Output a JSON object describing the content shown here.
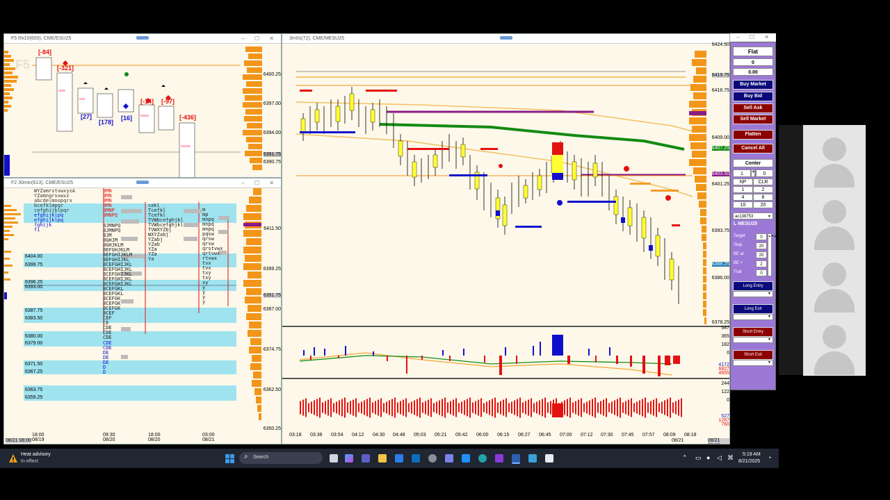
{
  "left_top_window": {
    "title": "F5 Rx10(600), CME/ESU25",
    "watermark": "F5",
    "price_labels": [
      "6400.25",
      "6397.00",
      "6394.00",
      "6391.75",
      "6390.75"
    ],
    "delta_labels": [
      "[-84]",
      "[-321]",
      "[27]",
      "[178]",
      "[16]",
      "[-14]",
      "[-97]",
      "[-436]"
    ]
  },
  "left_bottom_window": {
    "title": "F2 30min(613), CME/ESU25",
    "price_labels": [
      "6411.50",
      "6399.25",
      "6387.00",
      "6374.75",
      "6362.50",
      "6350.25"
    ],
    "level_labels": [
      "6404.00",
      "6399.75",
      "6396.25",
      "6393.00",
      "6387.75",
      "6383.50",
      "6380.00",
      "6379.00",
      "6371.50",
      "6367.25",
      "6363.75",
      "6359.25"
    ],
    "time_labels": [
      "18:00\n08/19",
      "09:30\n08/20",
      "18:00\n08/20",
      "03:00\n08/21"
    ],
    "date_label": "08/21 08:00",
    "last_price": "6391.75"
  },
  "main_window": {
    "title": "3m0s(72), CME/MESU25",
    "price_labels": [
      "6419.75",
      "6416.75",
      "6409.00",
      "6401.25",
      "6393.75",
      "6386.00",
      "6378.25"
    ],
    "top_price": "6424.50",
    "tagged_prices": {
      "p1": "6419.75",
      "p2": "6407.25",
      "p3": "6403.50",
      "last": "6388.25"
    },
    "time_labels": [
      "03:18",
      "03:36",
      "03:54",
      "04:12",
      "04:30",
      "04:48",
      "05:03",
      "05:21",
      "05:42",
      "06:00",
      "06:15",
      "06:27",
      "06:45",
      "07:00",
      "07:12",
      "07:30",
      "07:45",
      "07:57",
      "08:09",
      "08:18"
    ],
    "date_mark": "08/21",
    "date_label": "08/21 08:18",
    "delta_axis": [
      "547",
      "365",
      "182",
      "0",
      "-182",
      "-365"
    ],
    "delta_values": [
      "4172",
      "6827",
      "4655"
    ],
    "vol_axis": [
      "244",
      "122",
      "0",
      "-122",
      "-244",
      "-366"
    ],
    "vol_values": [
      "527",
      "1287",
      "760"
    ]
  },
  "control_panel": {
    "status": "Flat",
    "position": "0",
    "pnl": "0.00",
    "buy_market": "Buy Market",
    "buy_bid": "Buy Bid",
    "sell_ask": "Sell Ask",
    "sell_market": "Sell Market",
    "flatten": "Flatten",
    "cancel_all": "Cancel All",
    "center": "Center",
    "qty": "1",
    "qty_right": "0",
    "np": "NP",
    "clr": "CLR",
    "qty_grid": [
      "1",
      "2",
      "4",
      "8",
      "10",
      "20"
    ],
    "account": "ac138753",
    "symbol": "L MESU25",
    "target_label": "Target",
    "target": "0",
    "stop_label": "Stop",
    "stop": "20",
    "be_at_label": "BE at",
    "be_at": "20",
    "be_plus_label": "BE +",
    "be_plus": "2",
    "trail_label": "Trail",
    "trail": "0",
    "long_entry": "Long Entry",
    "long_exit": "Long Exit",
    "short_entry": "Short Entry",
    "short_exit": "Short Exit"
  },
  "taskbar": {
    "weather_title": "Heat advisory",
    "weather_sub": "In effect",
    "search_placeholder": "Search",
    "time": "5:19 AM",
    "date": "8/21/2025"
  },
  "colors": {
    "chart_bg": "#fdf8e9",
    "yellow": "#ffff33",
    "red": "#e41111",
    "blue": "#1010cc",
    "orange": "#f39519",
    "green": "#138a13",
    "purple": "#8a1a8a",
    "panel_bg": "#9b78d6",
    "navy": "#0a0a7a",
    "maroon": "#8b0000"
  }
}
